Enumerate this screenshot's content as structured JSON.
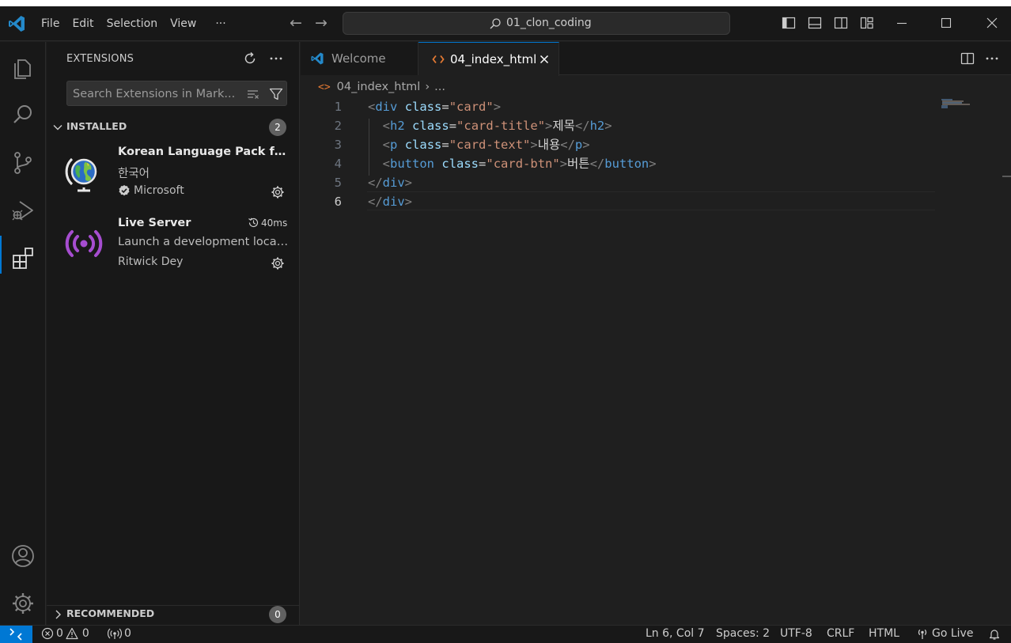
{
  "titlebar": {
    "menu": [
      "File",
      "Edit",
      "Selection",
      "View",
      "···"
    ],
    "search_text": "01_clon_coding"
  },
  "sidebar": {
    "title": "EXTENSIONS",
    "search_placeholder": "Search Extensions in Mark...",
    "installed": {
      "label": "INSTALLED",
      "count": "2",
      "items": [
        {
          "name": "Korean Language Pack for...",
          "description": "한국어",
          "publisher": "Microsoft",
          "verified": true,
          "icon": "globe-icon"
        },
        {
          "name": "Live Server",
          "timing": "40ms",
          "description": "Launch a development local...",
          "publisher": "Ritwick Dey",
          "icon": "live-server-icon"
        }
      ]
    },
    "recommended": {
      "label": "RECOMMENDED",
      "count": "0"
    }
  },
  "editor": {
    "tabs": [
      {
        "label": "Welcome",
        "active": false
      },
      {
        "label": "04_index_html",
        "active": true
      }
    ],
    "breadcrumb": {
      "file": "04_index_html",
      "more": "..."
    },
    "lines": [
      {
        "n": "1",
        "html": "<span class=\"brk\">&lt;</span><span class=\"tag\">div</span> <span class=\"attr\">class</span><span class=\"txt\">=</span><span class=\"str\">\"card\"</span><span class=\"brk\">&gt;</span>"
      },
      {
        "n": "2",
        "html": "  <span class=\"brk\">&lt;</span><span class=\"tag\">h2</span> <span class=\"attr\">class</span><span class=\"txt\">=</span><span class=\"str\">\"card-title\"</span><span class=\"brk\">&gt;</span><span class=\"txt\">제목</span><span class=\"brk\">&lt;/</span><span class=\"tag\">h2</span><span class=\"brk\">&gt;</span>"
      },
      {
        "n": "3",
        "html": "  <span class=\"brk\">&lt;</span><span class=\"tag\">p</span> <span class=\"attr\">class</span><span class=\"txt\">=</span><span class=\"str\">\"card-text\"</span><span class=\"brk\">&gt;</span><span class=\"txt\">내용</span><span class=\"brk\">&lt;/</span><span class=\"tag\">p</span><span class=\"brk\">&gt;</span>"
      },
      {
        "n": "4",
        "html": "  <span class=\"brk\">&lt;</span><span class=\"tag\">button</span> <span class=\"attr\">class</span><span class=\"txt\">=</span><span class=\"str\">\"card-btn\"</span><span class=\"brk\">&gt;</span><span class=\"txt\">버튼</span><span class=\"brk\">&lt;/</span><span class=\"tag\">button</span><span class=\"brk\">&gt;</span>"
      },
      {
        "n": "5",
        "html": "<span class=\"brk\">&lt;/</span><span class=\"tag\">div</span><span class=\"brk\">&gt;</span>"
      },
      {
        "n": "6",
        "html": "<span class=\"brk\">&lt;/</span><span class=\"tag\">div</span><span class=\"brk\">&gt;</span>"
      }
    ]
  },
  "statusbar": {
    "errors": "0",
    "warnings": "0",
    "ports": "0",
    "position": "Ln 6, Col 7",
    "spaces": "Spaces: 2",
    "encoding": "UTF-8",
    "eol": "CRLF",
    "language": "HTML",
    "golive": "Go Live"
  },
  "colors": {
    "accent": "#0078d4",
    "tag": "#569cd6",
    "attribute": "#9cdcfe",
    "string": "#ce9178"
  }
}
